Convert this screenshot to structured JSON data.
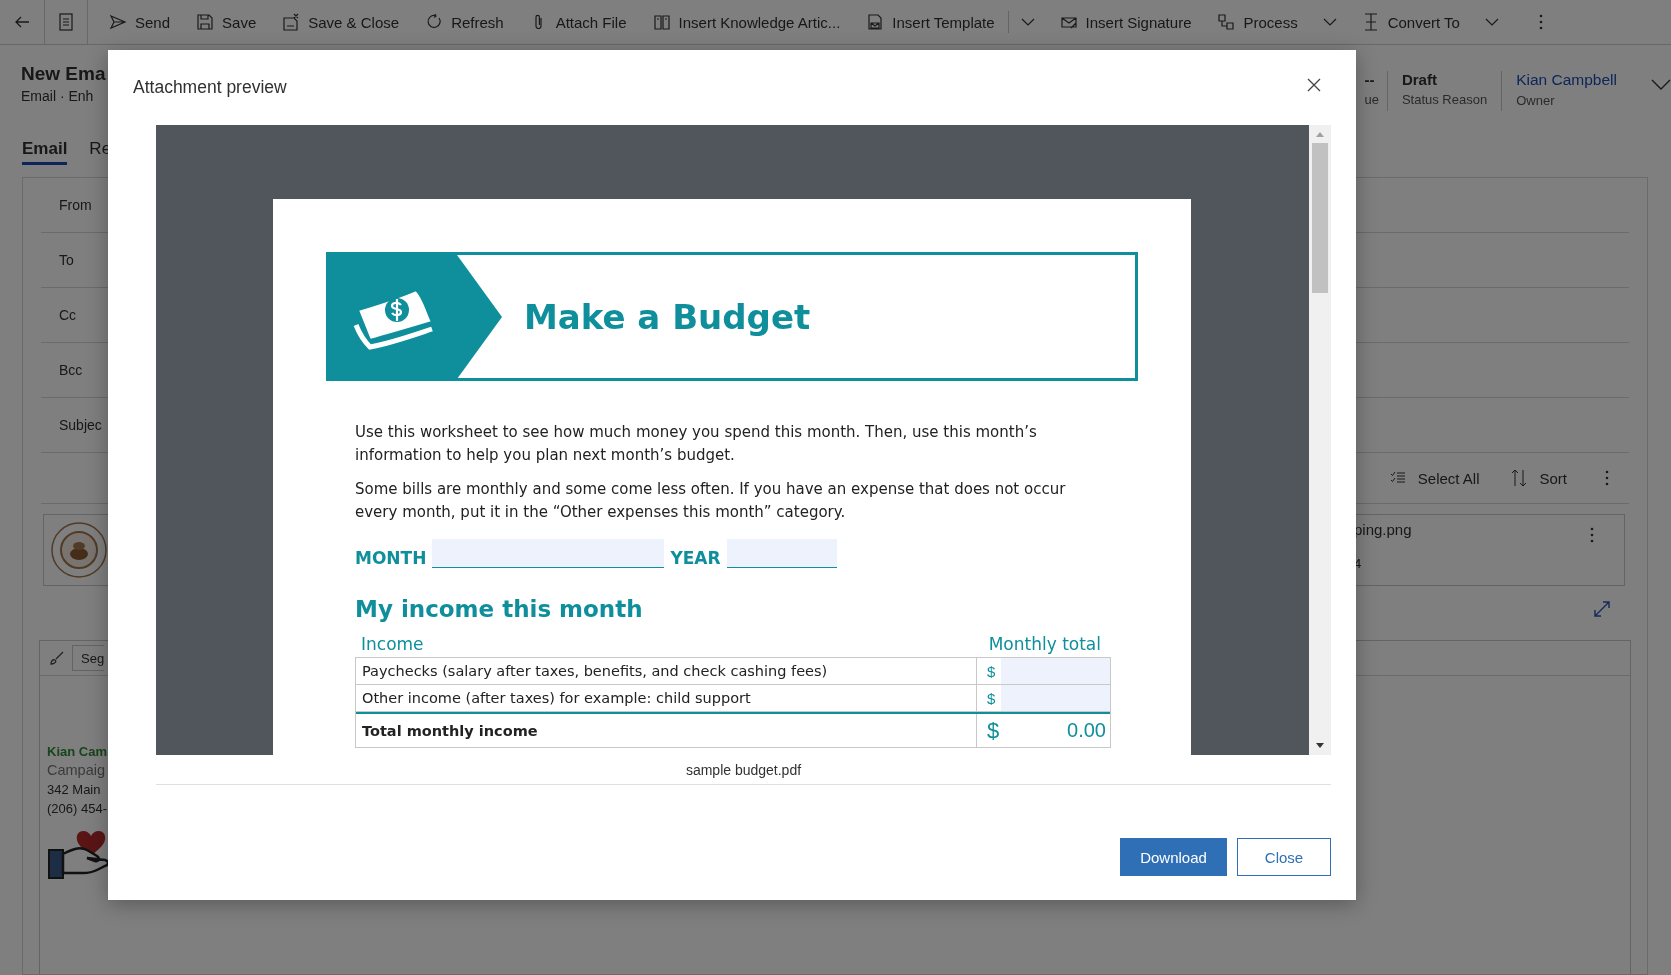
{
  "toolbar": {
    "items": [
      {
        "label": "Send",
        "menu": false
      },
      {
        "label": "Save",
        "menu": false
      },
      {
        "label": "Save & Close",
        "menu": false
      },
      {
        "label": "Refresh",
        "menu": false
      },
      {
        "label": "Attach File",
        "menu": false
      },
      {
        "label": "Insert Knowledge Artic...",
        "menu": false
      },
      {
        "label": "Insert Template",
        "menu": true
      },
      {
        "label": "Insert Signature",
        "menu": false
      },
      {
        "label": "Process",
        "menu": true
      },
      {
        "label": "Convert To",
        "menu": true
      }
    ]
  },
  "record": {
    "title": "New Ema",
    "subtitle": "Email · Enh"
  },
  "header_fields": [
    {
      "value": "--",
      "label": "ue",
      "kind": "text"
    },
    {
      "value": "Draft",
      "label": "Status Reason",
      "kind": "text"
    },
    {
      "value": "Kian Campbell",
      "label": "Owner",
      "kind": "link"
    }
  ],
  "tabs": [
    {
      "label": "Email",
      "selected": true
    },
    {
      "label": "Re",
      "selected": false
    }
  ],
  "form": {
    "fields": [
      "From",
      "To",
      "Cc",
      "Bcc",
      "Subjec"
    ]
  },
  "attachments": {
    "actions": [
      "Select All",
      "Sort"
    ],
    "file_name": "ping.png",
    "file_size": "4"
  },
  "editor": {
    "toolbar_button": "Seg",
    "signature": {
      "name": "Kian Cam",
      "role": "Campaig",
      "address": "342 Main",
      "phone": "(206) 454-"
    }
  },
  "dialog": {
    "title": "Attachment preview",
    "file_name": "sample budget.pdf",
    "buttons": [
      {
        "label": "Download",
        "kind": "primary"
      },
      {
        "label": "Close",
        "kind": "secondary"
      }
    ],
    "document": {
      "title": "Make a Budget",
      "paragraphs": [
        "Use this worksheet to see how much money you spend this month. Then, use this month’s information to help you plan next month’s budget.",
        "Some bills are monthly and some come less often. If you have an expense that does not occur every month, put it in the “Other expenses this month” category."
      ],
      "month_label": "MONTH",
      "year_label": "YEAR",
      "section_title": "My income this month",
      "columns": [
        "Income",
        "Monthly total"
      ],
      "rows": [
        {
          "label": "Paychecks (salary after taxes, benefits, and check cashing fees)",
          "currency": "$",
          "kind": "entry"
        },
        {
          "label": "Other income (after taxes) for example: child support",
          "currency": "$",
          "kind": "entry"
        },
        {
          "label": "Total monthly income",
          "currency": "$",
          "amount": "0.00",
          "kind": "total"
        }
      ]
    }
  }
}
